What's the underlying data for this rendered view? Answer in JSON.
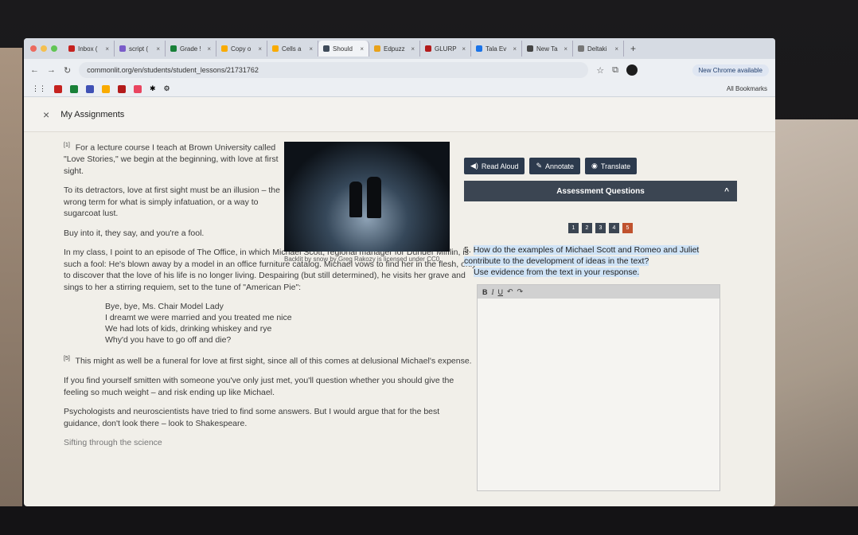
{
  "browser": {
    "tabs": [
      {
        "label": "Inbox (",
        "color": "#c5221f",
        "active": false
      },
      {
        "label": "script (",
        "color": "#7a5cc9",
        "active": false
      },
      {
        "label": "Grade !",
        "color": "#188038",
        "active": false
      },
      {
        "label": "Copy o",
        "color": "#f9ab00",
        "active": false
      },
      {
        "label": "Cells a",
        "color": "#f9ab00",
        "active": false
      },
      {
        "label": "Should",
        "color": "#3f4b5a",
        "active": true
      },
      {
        "label": "Edpuzz",
        "color": "#e8a21a",
        "active": false
      },
      {
        "label": "GLURP",
        "color": "#b31b1b",
        "active": false
      },
      {
        "label": "Tala Ev",
        "color": "#1a73e8",
        "active": false
      },
      {
        "label": "New Ta",
        "color": "#444444",
        "active": false
      },
      {
        "label": "Deltaki",
        "color": "#777777",
        "active": false
      }
    ],
    "tab_close": "×",
    "new_tab": "+",
    "url": "commonlit.org/en/students/student_lessons/21731762",
    "chrome_available": "New Chrome available",
    "all_bookmarks": "All Bookmarks"
  },
  "app": {
    "close": "×",
    "title": "My Assignments"
  },
  "article": {
    "p1_num": "[1]",
    "p1": "For a lecture course I teach at Brown University called \"Love Stories,\" we begin at the beginning, with love at first sight.",
    "p2": "To its detractors, love at first sight must be an illusion – the wrong term for what is simply infatuation, or a way to sugarcoat lust.",
    "p3": "Buy into it, they say, and you're a fool.",
    "p4": "In my class, I point to an episode of The Office, in which Michael Scott, regional manager for Dunder Mifflin, is such a fool: He's blown away by a model in an office furniture catalog. Michael vows to find her in the flesh, only to discover that the love of his life is no longer living. Despairing (but still determined), he visits her grave and sings to her a stirring requiem, set to the tune of \"American Pie\":",
    "poem": [
      "Bye, bye, Ms. Chair Model Lady",
      "I dreamt we were married and you treated me nice",
      "We had lots of kids, drinking whiskey and rye",
      "Why'd you have to go off and die?"
    ],
    "p5_num": "[5]",
    "p5": "This might as well be a funeral for love at first sight, since all of this comes at delusional Michael's expense.",
    "p6": "If you find yourself smitten with someone you've only just met, you'll question whether you should give the feeling so much weight – and risk ending up like Michael.",
    "p7": "Psychologists and neuroscientists have tried to find some answers. But I would argue that for the best guidance, don't look there – look to Shakespeare.",
    "cut_heading": "Sifting through the science",
    "caption": "Backlit by snow by Greg Rakozy is licensed under CC0."
  },
  "panel": {
    "read_aloud": "Read Aloud",
    "annotate": "Annotate",
    "translate": "Translate",
    "header": "Assessment Questions",
    "caret": "^",
    "question_numbers": [
      "1",
      "2",
      "3",
      "4",
      "5"
    ],
    "active_question": "5",
    "question_num": "5.",
    "question_text": "How do the examples of Michael Scott and Romeo and Juliet contribute to the development of ideas in the text?",
    "question_instruction": "Use evidence from the text in your response.",
    "toolbar": {
      "bold": "B",
      "italic": "I",
      "underline": "U",
      "undo": "↶",
      "redo": "↷"
    }
  }
}
